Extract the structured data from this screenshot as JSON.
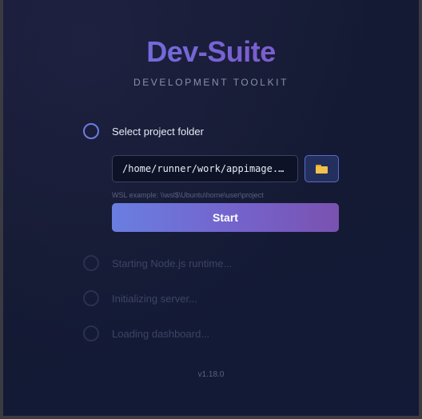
{
  "app": {
    "title": "Dev-Suite",
    "subtitle": "DEVELOPMENT TOOLKIT",
    "version": "v1.18.0"
  },
  "steps": [
    {
      "label": "Select project folder",
      "state": "active"
    },
    {
      "label": "Starting Node.js runtime...",
      "state": "pending"
    },
    {
      "label": "Initializing server...",
      "state": "pending"
    },
    {
      "label": "Loading dashboard...",
      "state": "pending"
    }
  ],
  "folder_picker": {
    "value": "/home/runner/work/appimage...",
    "browse_icon": "folder-icon",
    "hint": "WSL example: \\\\wsl$\\Ubuntu\\home\\user\\project"
  },
  "start_button": {
    "label": "Start"
  },
  "colors": {
    "accent": "#6a7ee0",
    "accent_end": "#7a52b0",
    "background": "#141a33",
    "folder_icon": "#f2c24a"
  }
}
